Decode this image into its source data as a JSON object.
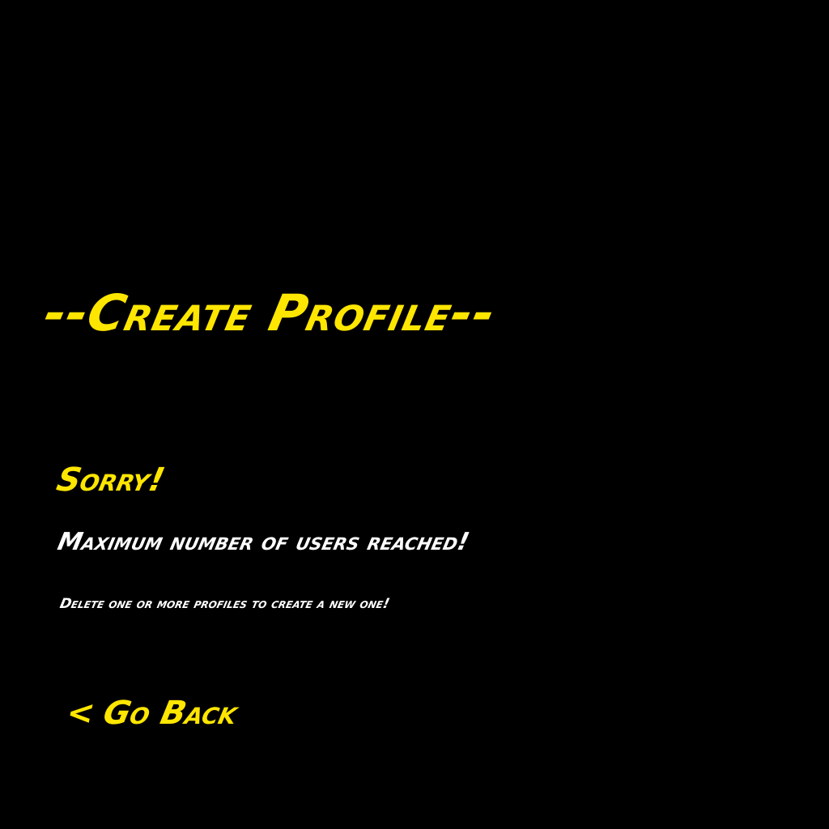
{
  "screen": {
    "title": "--Create Profile--",
    "sorry": "Sorry!",
    "message": "Maximum number of users reached!",
    "hint": "Delete one or more profiles to create a new one!",
    "back": {
      "chevron": "<",
      "label": "Go Back"
    }
  },
  "colors": {
    "background": "#000000",
    "accent": "#ffe600",
    "text": "#ffffff"
  },
  "icons": {
    "back": "chevron-left-icon"
  }
}
